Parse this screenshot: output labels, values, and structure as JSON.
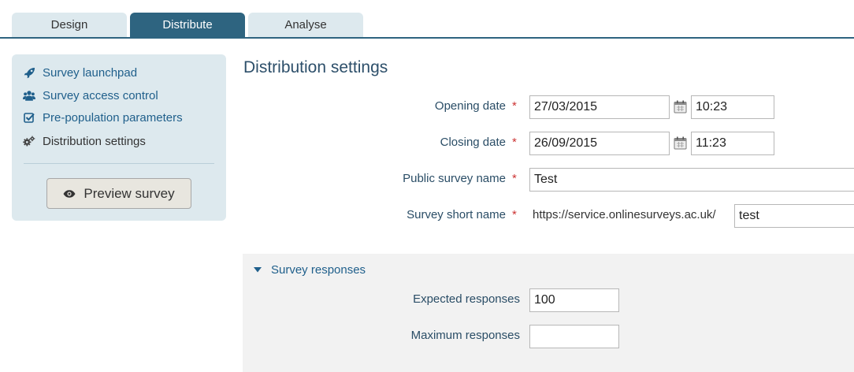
{
  "tabs": [
    {
      "label": "Design",
      "active": false
    },
    {
      "label": "Distribute",
      "active": true
    },
    {
      "label": "Analyse",
      "active": false
    }
  ],
  "sidebar": {
    "items": [
      {
        "label": "Survey launchpad",
        "icon": "rocket-icon"
      },
      {
        "label": "Survey access control",
        "icon": "users-icon"
      },
      {
        "label": "Pre-population parameters",
        "icon": "checkbox-icon"
      },
      {
        "label": "Distribution settings",
        "icon": "gears-icon",
        "current": true
      }
    ],
    "preview_button": "Preview survey"
  },
  "main": {
    "title": "Distribution settings",
    "fields": {
      "opening_date": {
        "label": "Opening date",
        "date": "27/03/2015",
        "time": "10:23"
      },
      "closing_date": {
        "label": "Closing date",
        "date": "26/09/2015",
        "time": "11:23"
      },
      "public_name": {
        "label": "Public survey name",
        "value": "Test"
      },
      "short_name": {
        "label": "Survey short name",
        "prefix": "https://service.onlinesurveys.ac.uk/",
        "value": "test"
      }
    },
    "required_marker": "*",
    "responses": {
      "title": "Survey responses",
      "expected": {
        "label": "Expected responses",
        "value": "100"
      },
      "maximum": {
        "label": "Maximum responses",
        "value": ""
      }
    }
  },
  "colors": {
    "accent": "#2e6480",
    "link": "#1f5f8b",
    "panel": "#dde9ee",
    "required": "#cc3333"
  }
}
